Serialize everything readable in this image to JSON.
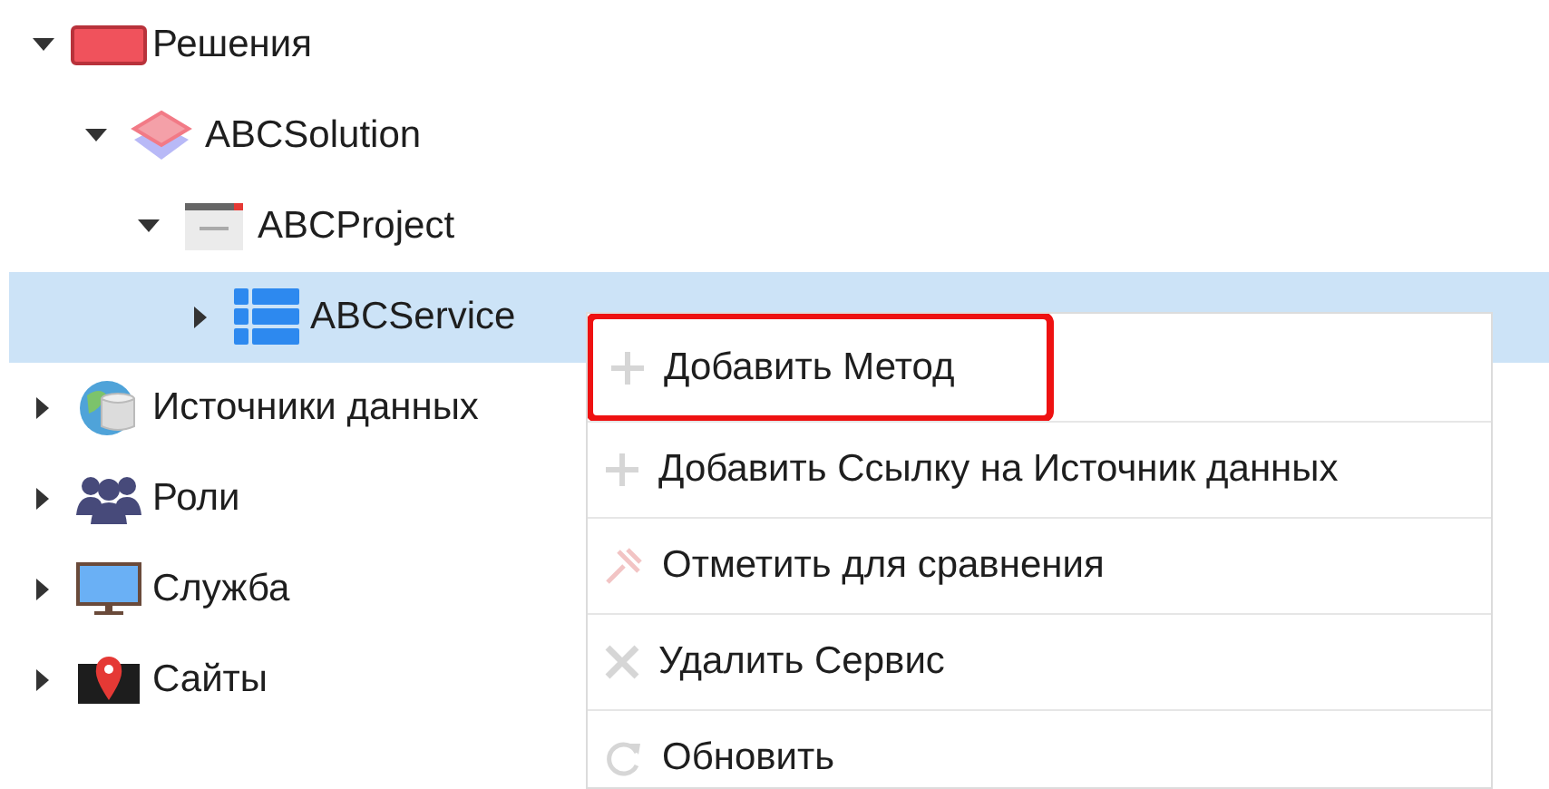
{
  "tree": [
    {
      "label": "Решения",
      "expanded": true,
      "selected": false,
      "children": [
        {
          "label": "ABCSolution",
          "expanded": true,
          "selected": false,
          "children": [
            {
              "label": "ABCProject",
              "expanded": true,
              "selected": false,
              "children": [
                {
                  "label": "ABCService",
                  "expanded": false,
                  "selected": true
                }
              ]
            }
          ]
        }
      ]
    },
    {
      "label": "Источники данных",
      "expanded": false,
      "selected": false
    },
    {
      "label": "Роли",
      "expanded": false,
      "selected": false
    },
    {
      "label": "Служба",
      "expanded": false,
      "selected": false
    },
    {
      "label": "Сайты",
      "expanded": false,
      "selected": false
    }
  ],
  "context_menu": {
    "items": [
      {
        "label": "Добавить Метод",
        "highlighted": true
      },
      {
        "label": "Добавить Ссылку на Источник данных",
        "highlighted": false
      },
      {
        "label": "Отметить для сравнения",
        "highlighted": false
      },
      {
        "label": "Удалить Сервис",
        "highlighted": false
      },
      {
        "label": "Обновить",
        "highlighted": false
      }
    ]
  }
}
